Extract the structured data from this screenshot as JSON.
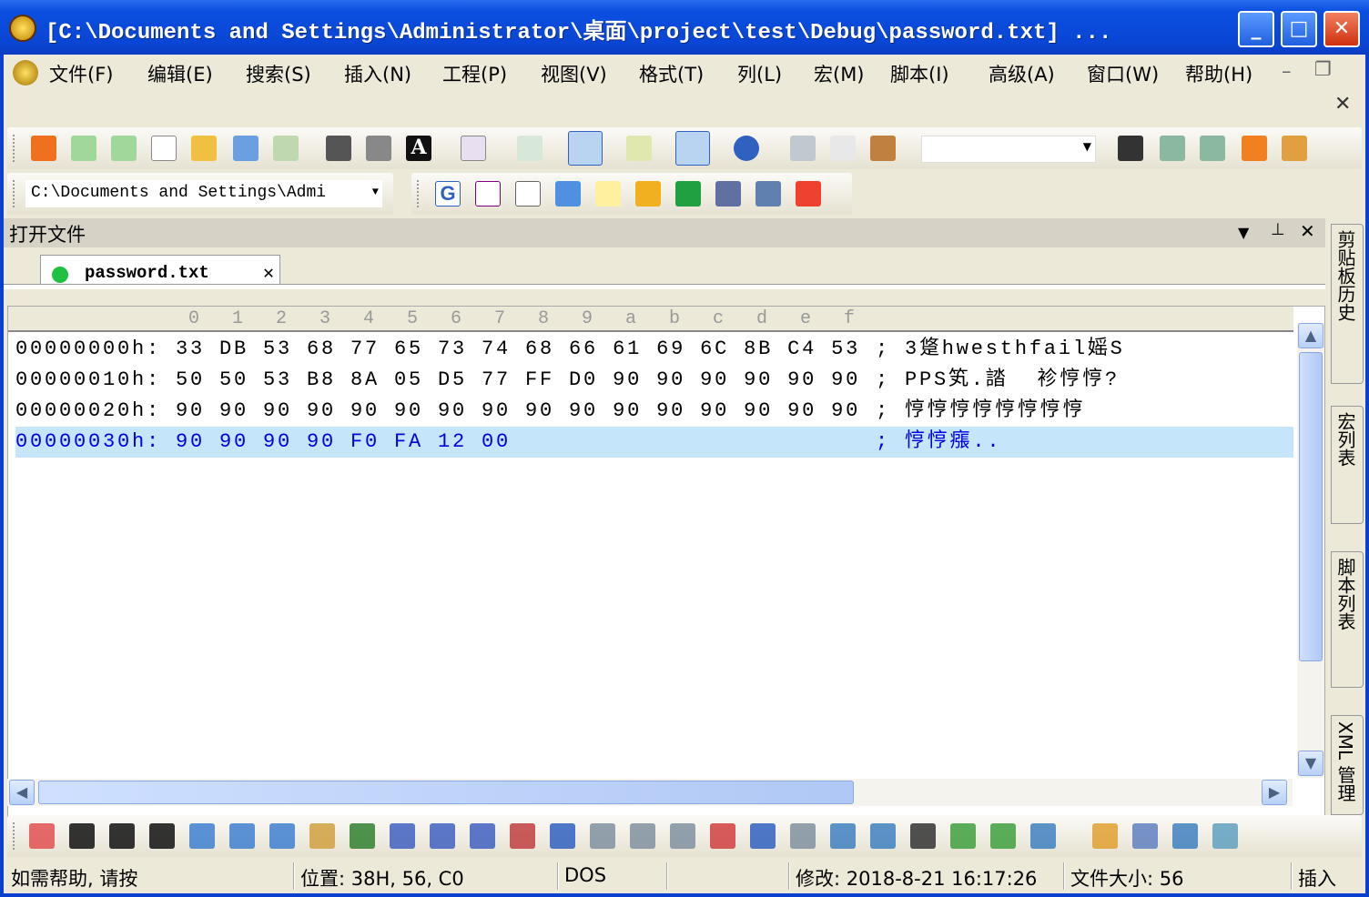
{
  "window": {
    "title": "[C:\\Documents and Settings\\Administrator\\桌面\\project\\test\\Debug\\password.txt] ...",
    "minimize": "_",
    "maximize": "□",
    "close": "✕"
  },
  "menu": [
    "文件(F)",
    "编辑(E)",
    "搜索(S)",
    "插入(N)",
    "工程(P)",
    "视图(V)",
    "格式(T)",
    "列(L)",
    "宏(M)",
    "脚本(I)",
    "高级(A)",
    "窗口(W)",
    "帮助(H)"
  ],
  "path_combo": "C:\\Documents and Settings\\Admi",
  "panel": {
    "title": "打开文件"
  },
  "tab": {
    "label": "password.txt"
  },
  "hex": {
    "columns": [
      "0",
      "1",
      "2",
      "3",
      "4",
      "5",
      "6",
      "7",
      "8",
      "9",
      "a",
      "b",
      "c",
      "d",
      "e",
      "f"
    ],
    "rows": [
      {
        "offset": "00000000h:",
        "bytes": "33 DB 53 68 77 65 73 74 68 66 61 69 6C 8B C4 53",
        "ascii": "3跾hwesthfail媱S"
      },
      {
        "offset": "00000010h:",
        "bytes": "50 50 53 B8 8A 05 D5 77 FF D0 90 90 90 90 90 90",
        "ascii": "PPS笂.誻  袗悙悙?"
      },
      {
        "offset": "00000020h:",
        "bytes": "90 90 90 90 90 90 90 90 90 90 90 90 90 90 90 90",
        "ascii": "悙悙悙悙悙悙悙悙"
      },
      {
        "offset": "00000030h:",
        "bytes": "90 90 90 90 F0 FA 12 00",
        "ascii": "悙悙瘬.."
      }
    ]
  },
  "side_tabs": [
    "剪贴板历史",
    "宏列表",
    "脚本列表",
    "XML 管理"
  ],
  "status": {
    "help": "如需帮助, 请按",
    "position": "位置: 38H, 56, C0",
    "format": "DOS",
    "modified": "修改: 2018-8-21 16:17:26",
    "filesize": "文件大小: 56",
    "mode": "插入"
  },
  "colors": {
    "titlebar": "#0a45d4",
    "selection": "#c5e5fb",
    "selected_text": "#0000e0"
  }
}
